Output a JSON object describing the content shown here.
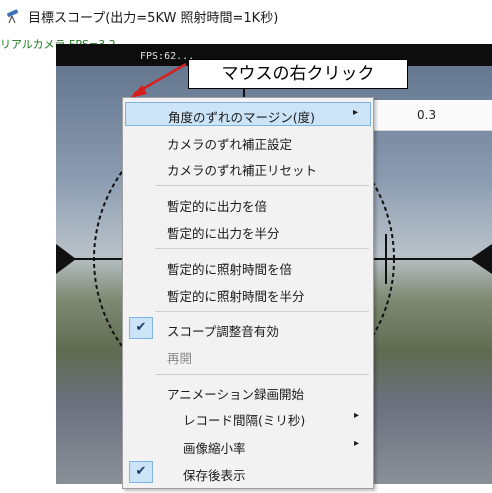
{
  "window": {
    "title": "目標スコープ(出力=5KW 照射時間=1K秒)",
    "fps_label": "リアルカメラ FPS=3.2"
  },
  "camera": {
    "overlay_text": "FPS:62..."
  },
  "callout": {
    "text": "マウスの右クリック"
  },
  "value_field": {
    "value": "0.3"
  },
  "menu": {
    "items": [
      {
        "label": "角度のずれのマージン(度)",
        "submenu": "▸",
        "highlighted": true
      },
      {
        "label": "カメラのずれ補正設定"
      },
      {
        "label": "カメラのずれ補正リセット"
      },
      {
        "label": "暫定的に出力を倍"
      },
      {
        "label": "暫定的に出力を半分"
      },
      {
        "label": "暫定的に照射時間を倍"
      },
      {
        "label": "暫定的に照射時間を半分"
      },
      {
        "label": "スコープ調整音有効",
        "checked": true,
        "check_glyph": "✔"
      },
      {
        "label": "再開",
        "disabled": true
      },
      {
        "label": "アニメーション録画開始"
      },
      {
        "label": "レコード間隔(ミリ秒)",
        "submenu": "▸"
      },
      {
        "label": "画像縮小率",
        "submenu": "▸"
      },
      {
        "label": "保存後表示",
        "checked": true,
        "check_glyph": "✔"
      }
    ]
  },
  "colors": {
    "highlight": "#cce4f7",
    "highlight_border": "#7fb4e0",
    "fps_text": "#1f7a1f",
    "menu_bg": "#f2f2f2"
  },
  "icons": {
    "app_icon": "telescope-icon",
    "check": "checkmark-icon",
    "submenu": "chevron-right-icon",
    "pointer": "red-arrow-icon"
  }
}
